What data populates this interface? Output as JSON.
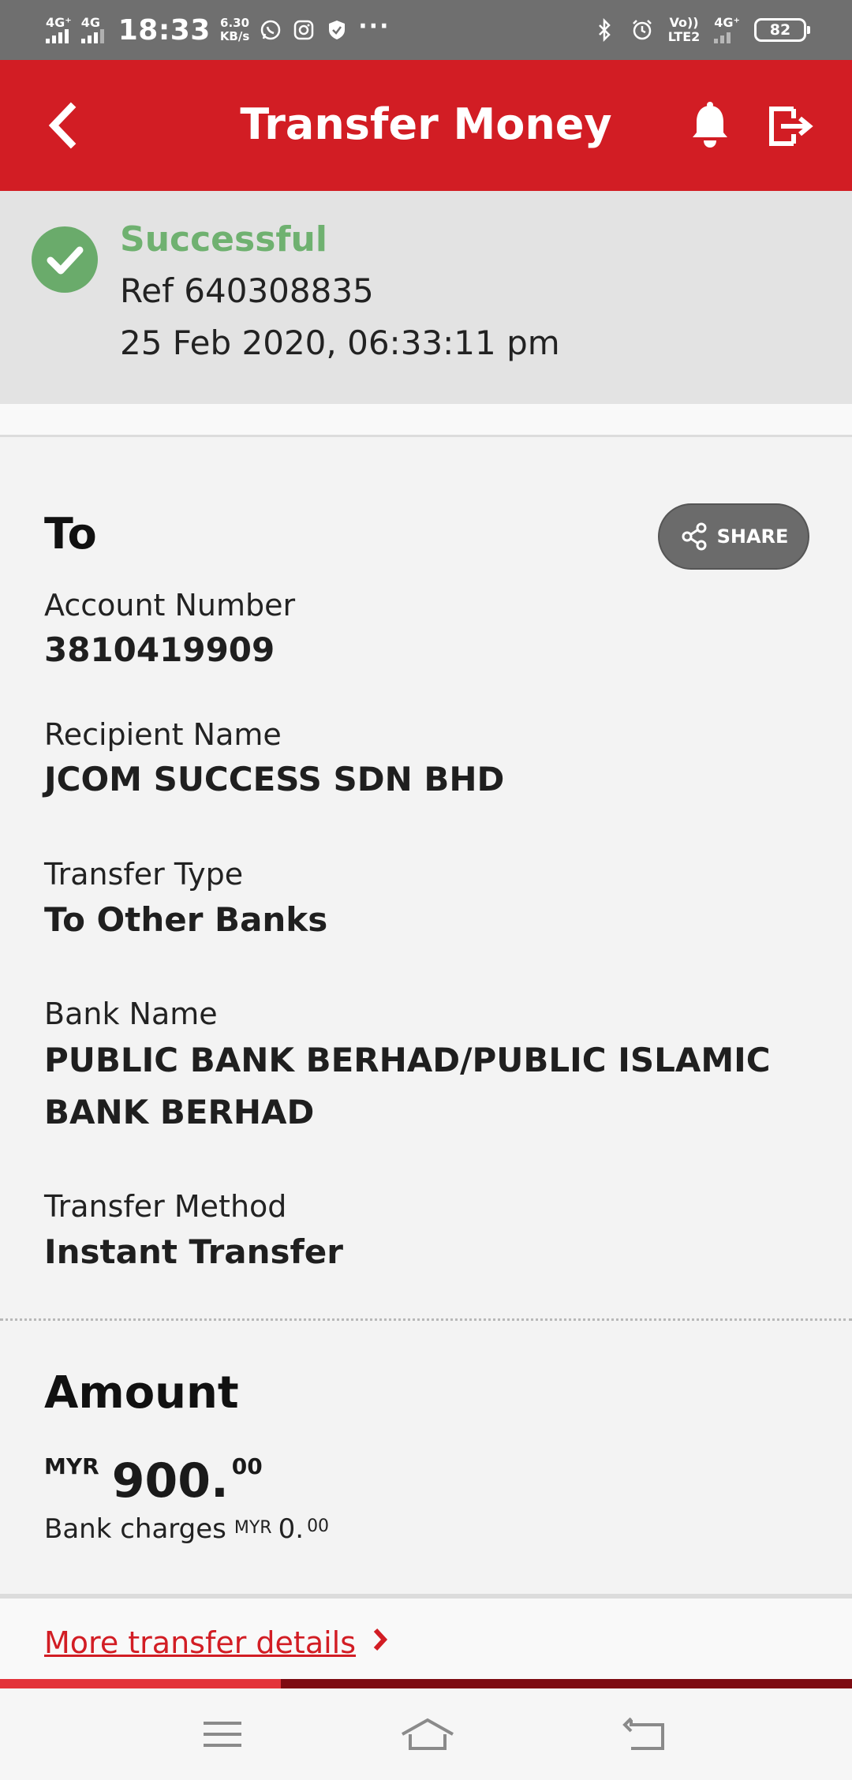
{
  "status_bar": {
    "network_1": "4G⁺",
    "network_2": "4G",
    "time": "18:33",
    "speed_value": "6.30",
    "speed_unit": "KB/s",
    "volte_top": "Vo))",
    "volte_bottom": "LTE2",
    "network_3": "4G⁺",
    "battery": "82",
    "more": "···"
  },
  "header": {
    "title": "Transfer Money"
  },
  "receipt": {
    "status": "Successful",
    "reference": "Ref 640308835",
    "datetime": "25 Feb 2020, 06:33:11 pm"
  },
  "recipient": {
    "heading": "To",
    "share_label": "SHARE",
    "fields": [
      {
        "label": "Account Number",
        "value": "3810419909"
      },
      {
        "label": "Recipient Name",
        "value": "JCOM SUCCESS SDN BHD"
      },
      {
        "label": "Transfer Type",
        "value": "To Other Banks"
      },
      {
        "label": "Bank Name",
        "value": "PUBLIC BANK BERHAD/PUBLIC ISLAMIC BANK BERHAD"
      },
      {
        "label": "Transfer Method",
        "value": "Instant Transfer"
      }
    ]
  },
  "amount": {
    "heading": "Amount",
    "currency": "MYR",
    "integer": "900.",
    "decimal": "00",
    "charges_label": "Bank charges",
    "charges_currency": "MYR",
    "charges_integer": "0.",
    "charges_decimal": "00"
  },
  "footer": {
    "more_details": "More transfer details",
    "progress_fraction": 0.33
  },
  "colors": {
    "brand_red": "#d21d24",
    "success_green": "#6fb170"
  },
  "icons": [
    "back-icon",
    "bell-icon",
    "logout-icon",
    "check-icon",
    "share-icon",
    "chevron-right-icon",
    "menu-icon",
    "home-icon",
    "back-nav-icon"
  ]
}
